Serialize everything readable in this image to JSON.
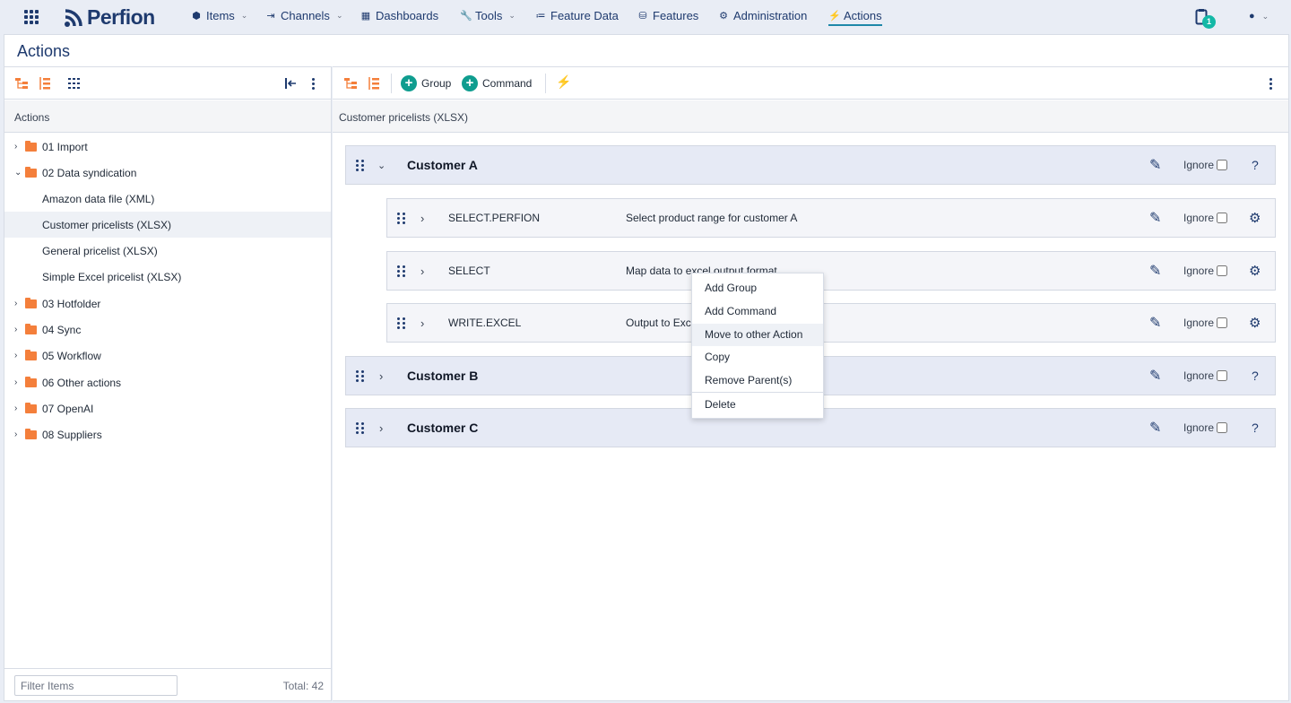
{
  "nav": {
    "logo": "Perfion",
    "menu": [
      {
        "label": "Items",
        "icon": "cube-icon"
      },
      {
        "label": "Channels",
        "icon": "channel-icon"
      },
      {
        "label": "Dashboards",
        "icon": "dashboard-icon"
      },
      {
        "label": "Tools",
        "icon": "wrench-icon"
      },
      {
        "label": "Feature Data",
        "icon": "list-icon"
      },
      {
        "label": "Features",
        "icon": "database-icon"
      },
      {
        "label": "Administration",
        "icon": "gear-icon"
      },
      {
        "label": "Actions",
        "icon": "lightning-icon"
      }
    ],
    "notification_count": "1"
  },
  "page": {
    "title": "Actions"
  },
  "left": {
    "header": "Actions",
    "tree": [
      {
        "label": "01 Import",
        "type": "folder",
        "expanded": false
      },
      {
        "label": "02 Data syndication",
        "type": "folder",
        "expanded": true
      },
      {
        "label": "Amazon data file (XML)",
        "type": "action"
      },
      {
        "label": "Customer pricelists (XLSX)",
        "type": "action",
        "selected": true
      },
      {
        "label": "General pricelist (XLSX)",
        "type": "action"
      },
      {
        "label": "Simple Excel pricelist (XLSX)",
        "type": "action"
      },
      {
        "label": "03 Hotfolder",
        "type": "folder",
        "expanded": false
      },
      {
        "label": "04 Sync",
        "type": "folder",
        "expanded": false
      },
      {
        "label": "05 Workflow",
        "type": "folder",
        "expanded": false
      },
      {
        "label": "06 Other actions",
        "type": "folder",
        "expanded": false
      },
      {
        "label": "07 OpenAI",
        "type": "folder",
        "expanded": false
      },
      {
        "label": "08 Suppliers",
        "type": "folder",
        "expanded": false
      }
    ],
    "filter_placeholder": "Filter Items",
    "total": "Total: 42"
  },
  "right": {
    "toolbar": {
      "group_label": "Group",
      "command_label": "Command"
    },
    "header": "Customer pricelists (XLSX)",
    "groups": [
      {
        "name": "Customer A",
        "expanded": true,
        "ignore_label": "Ignore",
        "help": "?"
      },
      {
        "name": "Customer B",
        "expanded": false,
        "ignore_label": "Ignore",
        "help": "?"
      },
      {
        "name": "Customer C",
        "expanded": false,
        "ignore_label": "Ignore",
        "help": "?"
      }
    ],
    "commands": [
      {
        "name": "SELECT.PERFION",
        "description": "Select product range for customer A",
        "ignore_label": "Ignore"
      },
      {
        "name": "SELECT",
        "description": "Map data to excel output format",
        "ignore_label": "Ignore"
      },
      {
        "name": "WRITE.EXCEL",
        "description": "Output to Excel",
        "ignore_label": "Ignore"
      }
    ]
  },
  "context_menu": {
    "items": [
      "Add Group",
      "Add Command",
      "Move to other Action",
      "Copy",
      "Remove Parent(s)",
      "Delete"
    ],
    "highlighted": "Move to other Action"
  },
  "colors": {
    "brand": "#1e3a6e",
    "accent": "#0f9d8f",
    "folder": "#f47f3b",
    "group_bg": "#e6eaf5"
  }
}
